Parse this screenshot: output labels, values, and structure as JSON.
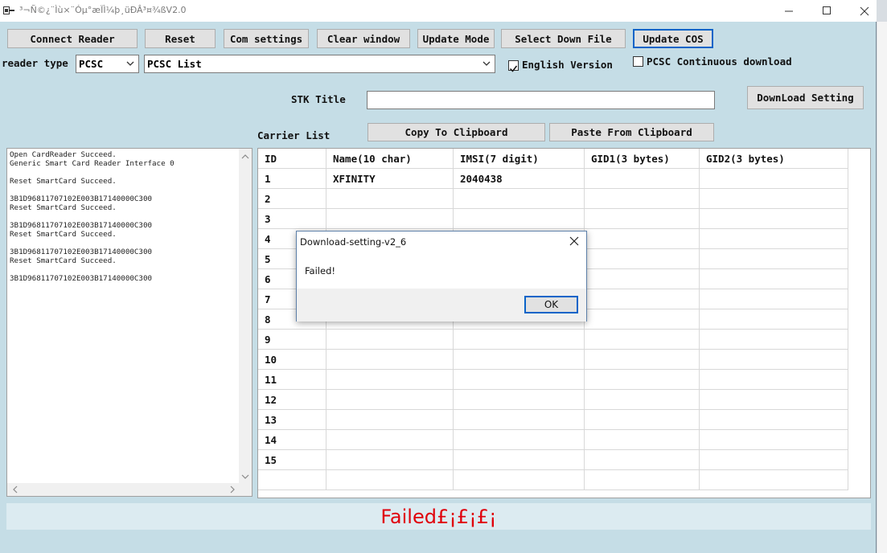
{
  "window": {
    "title": "³¬Ñ©¿¨Ìù×¨Óµ°æÏÌ¼þ¸üÐÂ³¤¾ßV2.0",
    "icon": "app-icon",
    "controls": [
      "minimize-icon",
      "maximize-icon",
      "close-icon"
    ]
  },
  "toolbar": {
    "connect_reader": "Connect Reader",
    "reset": "Reset",
    "com_settings": "Com settings",
    "clear_window": "Clear window",
    "update_mode": "Update Mode",
    "select_down_file": "Select Down File",
    "update_cos": "Update COS"
  },
  "reader": {
    "type_label": "reader type",
    "type_value": "PCSC",
    "list_value": "PCSC List",
    "english_label": "English Version",
    "english_checked": true,
    "continuous_label": "PCSC Continuous download",
    "continuous_checked": false
  },
  "stk": {
    "title_label": "STK Title",
    "title_value": "",
    "download_setting": "DownLoad Setting",
    "carrier_list_label": "Carrier List",
    "copy_to_clipboard": "Copy To Clipboard",
    "paste_from_clipboard": "Paste From Clipboard"
  },
  "log": {
    "lines": "Open CardReader Succeed.\nGeneric Smart Card Reader Interface 0\n\nReset SmartCard Succeed.\n\n3B1D96811707102E003B17140000C300\nReset SmartCard Succeed.\n\n3B1D96811707102E003B17140000C300\nReset SmartCard Succeed.\n\n3B1D96811707102E003B17140000C300\nReset SmartCard Succeed.\n\n3B1D96811707102E003B17140000C300"
  },
  "carrier_table": {
    "headers": [
      "ID",
      "Name(10 char)",
      "IMSI(7 digit)",
      "GID1(3 bytes)",
      "GID2(3 bytes)"
    ],
    "rows": [
      {
        "id": "1",
        "name": "XFINITY",
        "imsi": "2040438",
        "gid1": "",
        "gid2": ""
      },
      {
        "id": "2",
        "name": "",
        "imsi": "",
        "gid1": "",
        "gid2": ""
      },
      {
        "id": "3",
        "name": "",
        "imsi": "",
        "gid1": "",
        "gid2": ""
      },
      {
        "id": "4",
        "name": "",
        "imsi": "",
        "gid1": "",
        "gid2": ""
      },
      {
        "id": "5",
        "name": "",
        "imsi": "",
        "gid1": "",
        "gid2": ""
      },
      {
        "id": "6",
        "name": "",
        "imsi": "",
        "gid1": "",
        "gid2": ""
      },
      {
        "id": "7",
        "name": "",
        "imsi": "",
        "gid1": "",
        "gid2": ""
      },
      {
        "id": "8",
        "name": "",
        "imsi": "",
        "gid1": "",
        "gid2": ""
      },
      {
        "id": "9",
        "name": "",
        "imsi": "",
        "gid1": "",
        "gid2": ""
      },
      {
        "id": "10",
        "name": "",
        "imsi": "",
        "gid1": "",
        "gid2": ""
      },
      {
        "id": "11",
        "name": "",
        "imsi": "",
        "gid1": "",
        "gid2": ""
      },
      {
        "id": "12",
        "name": "",
        "imsi": "",
        "gid1": "",
        "gid2": ""
      },
      {
        "id": "13",
        "name": "",
        "imsi": "",
        "gid1": "",
        "gid2": ""
      },
      {
        "id": "14",
        "name": "",
        "imsi": "",
        "gid1": "",
        "gid2": ""
      },
      {
        "id": "15",
        "name": "",
        "imsi": "",
        "gid1": "",
        "gid2": ""
      },
      {
        "id": "",
        "name": "",
        "imsi": "",
        "gid1": "",
        "gid2": ""
      }
    ]
  },
  "dialog": {
    "title": "Download-setting-v2_6",
    "message": "Failed!",
    "ok": "OK"
  },
  "status": {
    "text": "Failed£¡£¡£¡",
    "color": "#e0000b"
  },
  "colors": {
    "window_bg": "#c5dde6",
    "focus_border": "#0a64c8"
  }
}
